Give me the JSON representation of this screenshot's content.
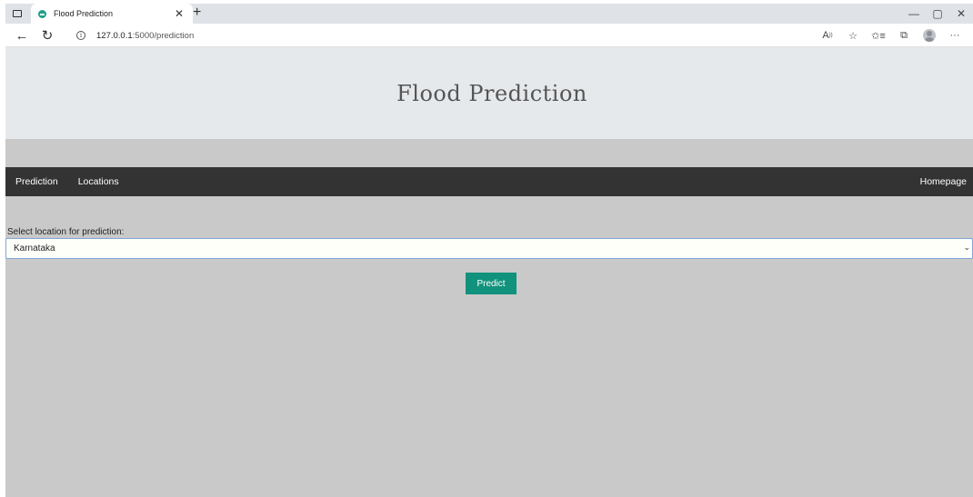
{
  "browser": {
    "tab_title": "Flood Prediction",
    "url_host": "127.0.0.1",
    "url_rest": ":5000/prediction"
  },
  "page": {
    "title": "Flood Prediction",
    "nav": {
      "prediction": "Prediction",
      "locations": "Locations",
      "homepage": "Homepage"
    },
    "form": {
      "label": "Select location for prediction:",
      "selected_location": "Karnataka",
      "submit_label": "Predict"
    }
  },
  "colors": {
    "page_background": "#c9c9c9",
    "hero_background": "#e6e9ec",
    "navbar_background": "#333333",
    "predict_button": "#11927c"
  }
}
